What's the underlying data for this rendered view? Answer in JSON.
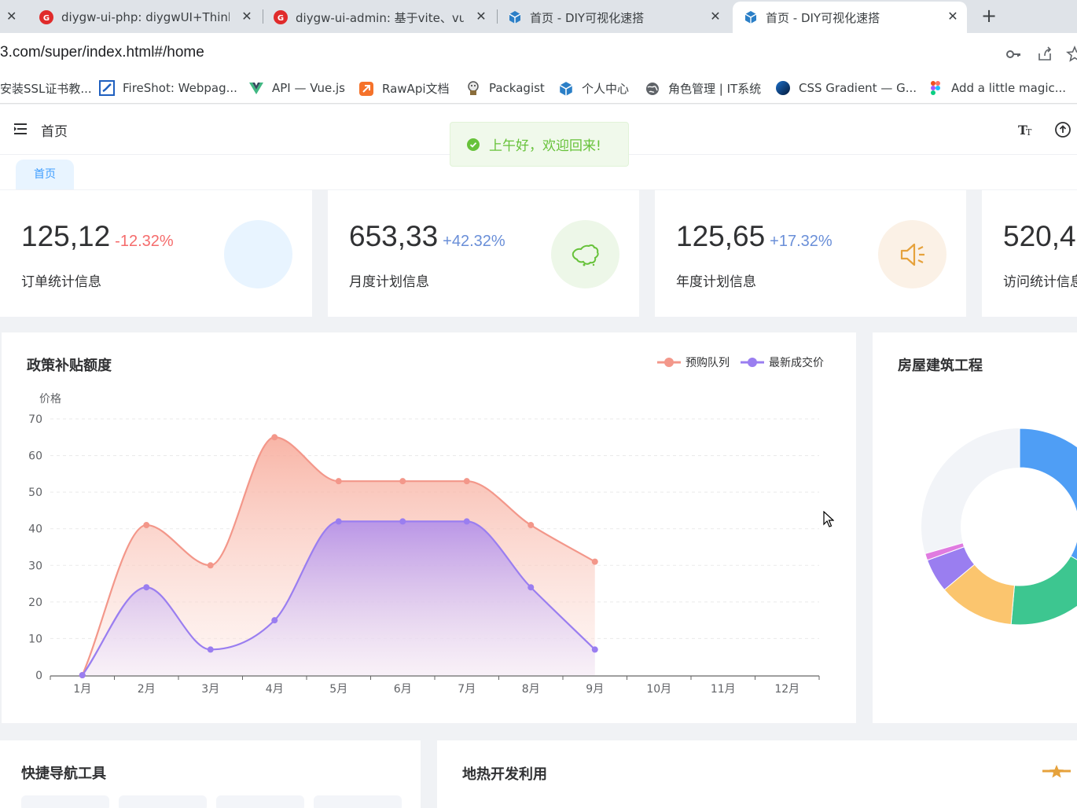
{
  "browser": {
    "tabs": [
      {
        "title": "diygw-ui-php: diygwUI+Think",
        "favicon": "diygw-logo-icon",
        "active": false
      },
      {
        "title": "diygw-ui-admin: 基于vite、vu",
        "favicon": "diygw-logo-icon",
        "active": false
      },
      {
        "title": "首页 - DIY可视化速搭",
        "favicon": "cube-icon",
        "active": false
      },
      {
        "title": "首页 - DIY可视化速搭",
        "favicon": "cube-icon",
        "active": true
      }
    ],
    "address": "3.com/super/index.html#/home",
    "bookmarks": [
      {
        "label": "安装SSL证书教...",
        "icon": "blank-icon"
      },
      {
        "label": "FireShot: Webpag...",
        "icon": "fireshot-icon"
      },
      {
        "label": "API — Vue.js",
        "icon": "vue-icon"
      },
      {
        "label": "RawApi文档",
        "icon": "rawapi-icon"
      },
      {
        "label": "Packagist",
        "icon": "packagist-icon"
      },
      {
        "label": "个人中心",
        "icon": "cube-icon"
      },
      {
        "label": "角色管理 | IT系统",
        "icon": "globe-icon"
      },
      {
        "label": "CSS Gradient — G...",
        "icon": "gradient-icon"
      },
      {
        "label": "Add a little magic...",
        "icon": "figma-icon"
      }
    ]
  },
  "app": {
    "breadcrumb": "首页",
    "tag": "首页",
    "toast": "上午好，欢迎回来!",
    "stats": [
      {
        "number": "125,12",
        "change": "-12.32%",
        "change_color": "#f56c6c",
        "label": "订单统计信息",
        "circle_color": "#e8f4ff",
        "icon": null
      },
      {
        "number": "653,33",
        "change": "+42.32%",
        "change_color": "#6a8fd8",
        "label": "月度计划信息",
        "circle_color": "#edf7e8",
        "icon": "china-map-icon"
      },
      {
        "number": "125,65",
        "change": "+17.32%",
        "change_color": "#6a8fd8",
        "label": "年度计划信息",
        "circle_color": "#fbf1e6",
        "icon": "speaker-icon"
      },
      {
        "number": "520,4",
        "change": "",
        "change_color": "#6a8fd8",
        "label": "访问统计信息",
        "circle_color": "#fff",
        "icon": null
      }
    ],
    "panels": {
      "policy_title": "政策补贴额度",
      "house_title": "房屋建筑工程",
      "nav_title": "快捷导航工具",
      "geo_title": "地热开发利用"
    }
  },
  "chart_data": {
    "type": "area",
    "title": "政策补贴额度",
    "ylabel": "价格",
    "categories": [
      "1月",
      "2月",
      "3月",
      "4月",
      "5月",
      "6月",
      "7月",
      "8月",
      "9月",
      "10月",
      "11月",
      "12月"
    ],
    "ylim": [
      0,
      70
    ],
    "yticks": [
      0,
      10,
      20,
      30,
      40,
      50,
      60,
      70
    ],
    "legend_position": "top-right",
    "smooth": true,
    "series": [
      {
        "name": "预购队列",
        "color": "#f3978a",
        "values": [
          0,
          41,
          30,
          65,
          53,
          53,
          53,
          41,
          31
        ]
      },
      {
        "name": "最新成交价",
        "color": "#9a7ef0",
        "values": [
          0,
          24,
          7,
          15,
          42,
          42,
          42,
          24,
          7
        ]
      }
    ]
  },
  "donut_data": {
    "segments": [
      {
        "color": "#4f9ef5"
      },
      {
        "color": "#3dc690"
      },
      {
        "color": "#fbc56e"
      },
      {
        "color": "#9a7ef0"
      },
      {
        "color": "#e07be0"
      }
    ]
  }
}
